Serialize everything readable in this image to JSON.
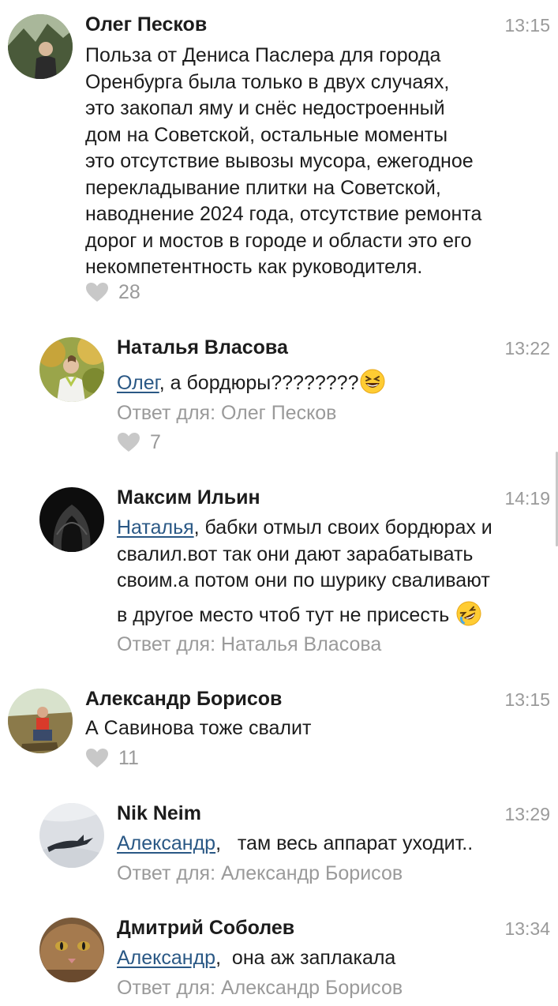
{
  "comments": [
    {
      "author": "Олег Песков",
      "time": "13:15",
      "lines": [
        "Польза от Дениса Паслера для города",
        "Оренбурга была только в двух случаях,",
        "это закопал яму и снёс недостроенный",
        "дом на Советской, остальные моменты",
        "это отсутствие вывозы мусора, ежегодное",
        "перекладывание плитки на Советской,",
        "наводнение 2024 года, отсутствие ремонта",
        "дорог и мостов в городе и области это его",
        "некомпетентность как руководителя."
      ],
      "likes": "28"
    },
    {
      "author": "Наталья Власова",
      "time": "13:22",
      "mention": "Олег",
      "text": ", а бордюры????????",
      "emoji": "grinning-squinting-emoji",
      "reply_to": "Ответ для: Олег Песков",
      "likes": "7"
    },
    {
      "author": "Максим Ильин",
      "time": "14:19",
      "mention": "Наталья",
      "line1": ", бабки отмыл своих бордюрах и",
      "line2": "свалил.вот так они дают зарабатывать",
      "line3": "своим.а потом они по шурику сваливают",
      "line4": "в другое место чтоб тут не присесть ",
      "emoji": "rolling-laughing-emoji",
      "reply_to": "Ответ для: Наталья Власова"
    },
    {
      "author": "Александр Борисов",
      "time": "13:15",
      "text": "А Савинова тоже свалит",
      "likes": "11"
    },
    {
      "author": "Nik Neim",
      "time": "13:29",
      "mention": "Александр",
      "text": ",   там весь аппарат уходит..",
      "reply_to": "Ответ для: Александр Борисов"
    },
    {
      "author": "Дмитрий Соболев",
      "time": "13:34",
      "mention": "Александр",
      "text": ",  она аж заплакала",
      "reply_to": "Ответ для: Александр Борисов"
    }
  ],
  "colors": {
    "mention": "#2a5885",
    "muted": "#9a9a9a",
    "text": "#1c1c1c",
    "heart": "#c8c8c8"
  }
}
